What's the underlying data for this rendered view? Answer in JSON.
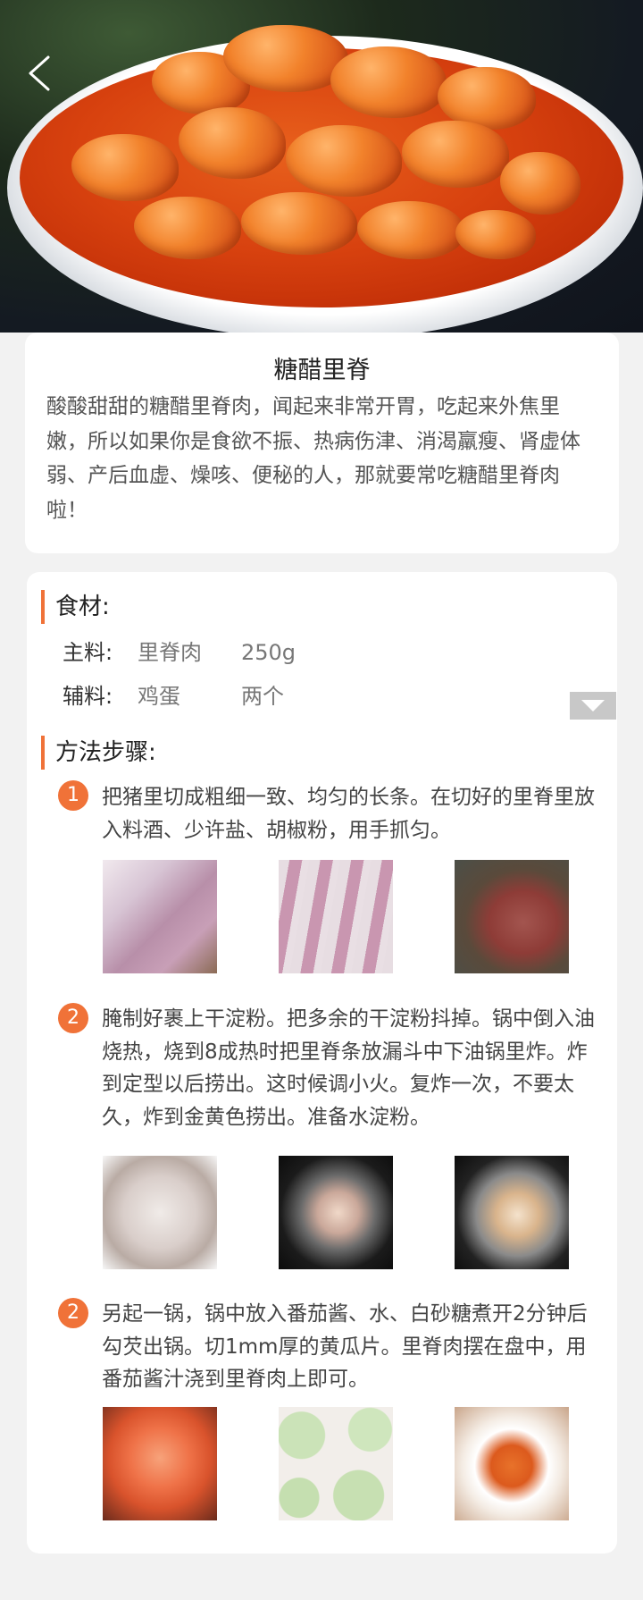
{
  "header": {
    "back_icon": "chevron-left-icon"
  },
  "recipe": {
    "title": "糖醋里脊",
    "description": "酸酸甜甜的糖醋里脊肉，闻起来非常开胃，吃起来外焦里嫩，所以如果你是食欲不振、热病伤津、消渴羸瘦、肾虚体弱、产后血虚、燥咳、便秘的人，那就要常吃糖醋里脊肉啦！"
  },
  "ingredients": {
    "heading": "食材:",
    "main_label": "主料:",
    "main_name": "里脊肉",
    "main_qty": "250g",
    "aux_label": "辅料:",
    "aux_name": "鸡蛋",
    "aux_qty": "两个",
    "expand_icon": "triangle-down-icon"
  },
  "steps": {
    "heading": "方法步骤:",
    "items": [
      {
        "num": "1",
        "text": "把猪里切成粗细一致、均匀的长条。在切好的里脊里放入料酒、少许盐、胡椒粉，用手抓匀。"
      },
      {
        "num": "2",
        "text": "腌制好裹上干淀粉。把多余的干淀粉抖掉。锅中倒入油烧热，烧到8成热时把里脊条放漏斗中下油锅里炸。炸到定型以后捞出。这时候调小火。复炸一次，不要太久，炸到金黄色捞出。准备水淀粉。"
      },
      {
        "num": "2",
        "text": "另起一锅，锅中放入番茄酱、水、白砂糖煮开2分钟后勾芡出锅。切1mm厚的黄瓜片。里脊肉摆在盘中，用番茄酱汁浇到里脊肉上即可。"
      }
    ]
  },
  "colors": {
    "accent": "#f07238",
    "background": "#f2f2f2",
    "card": "#ffffff"
  }
}
